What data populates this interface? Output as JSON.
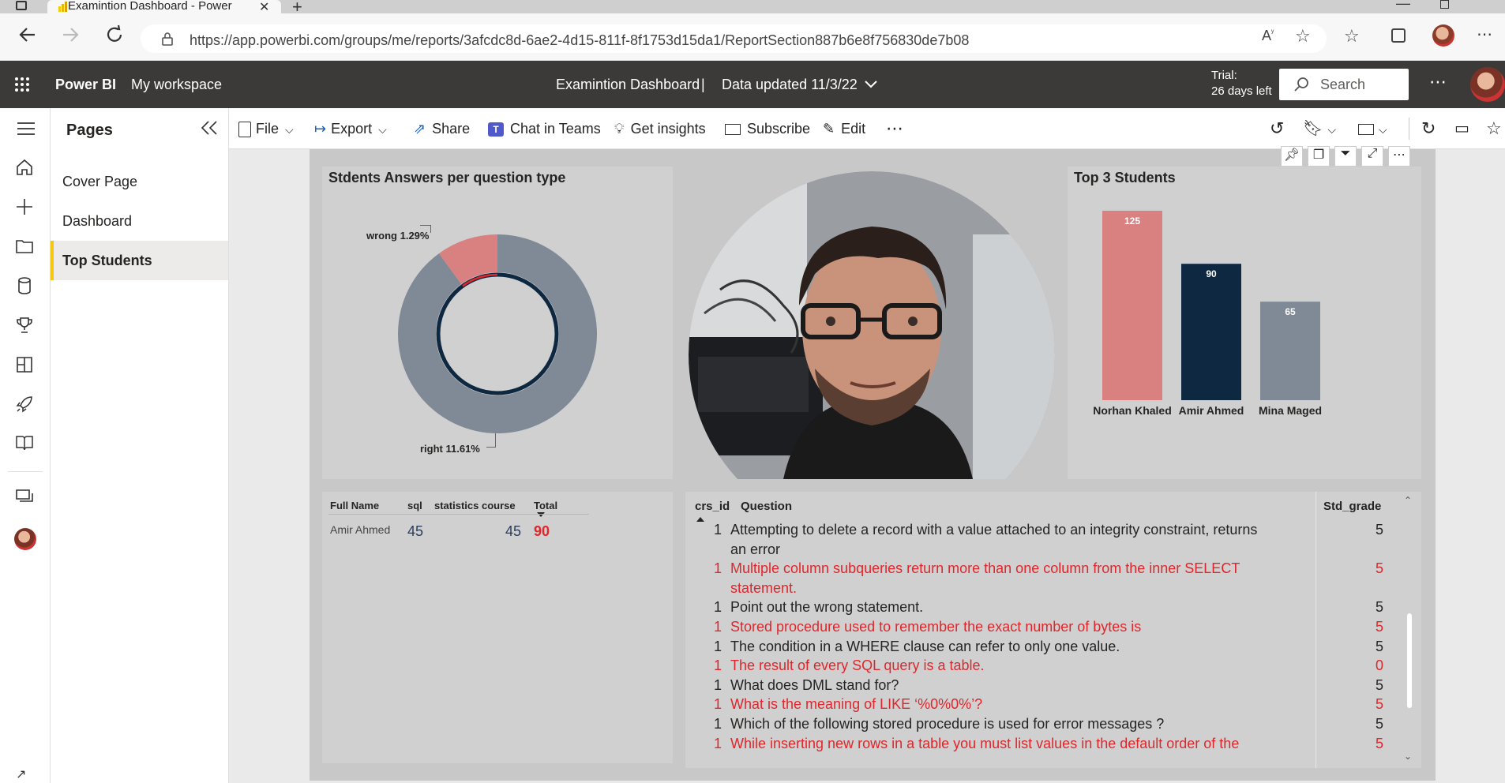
{
  "browser": {
    "tab_title": "Examintion Dashboard - Power BI",
    "url": "https://app.powerbi.com/groups/me/reports/3afcdc8d-6ae2-4d15-811f-8f1753d15da1/ReportSection887b6e8f756830de7b08"
  },
  "header": {
    "app_name": "Power BI",
    "workspace": "My workspace",
    "report_title": "Examintion Dashboard",
    "separator": "|",
    "data_updated": "Data updated 11/3/22",
    "trial_line1": "Trial:",
    "trial_line2": "26 days left",
    "search_placeholder": "Search"
  },
  "pages_pane": {
    "title": "Pages",
    "items": [
      {
        "label": "Cover Page",
        "active": false
      },
      {
        "label": "Dashboard",
        "active": false
      },
      {
        "label": "Top Students",
        "active": true
      }
    ]
  },
  "commands": {
    "file": "File",
    "export": "Export",
    "share": "Share",
    "chat": "Chat in Teams",
    "insights": "Get insights",
    "subscribe": "Subscribe",
    "edit": "Edit"
  },
  "donut_visual": {
    "title": "Stdents Answers per question type",
    "chart_data": {
      "type": "pie",
      "slices": [
        {
          "label": "wrong",
          "percent": 1.29,
          "color": "#d98080"
        },
        {
          "label": "right",
          "percent": 11.61,
          "color": "#808a96"
        }
      ],
      "annotations": [
        "wrong 1.29%",
        "right 11.61%"
      ]
    }
  },
  "bar_visual": {
    "title": "Top 3 Students",
    "chart_data": {
      "type": "bar",
      "categories": [
        "Norhan Khaled",
        "Amir Ahmed",
        "Mina Maged"
      ],
      "values": [
        125,
        90,
        65
      ],
      "colors": [
        "#d98080",
        "#0e2841",
        "#808a96"
      ],
      "data_labels": [
        "125",
        "90",
        "65"
      ]
    }
  },
  "summary_table": {
    "headers": [
      "Full Name",
      "sql",
      "statistics course",
      "Total"
    ],
    "rows": [
      {
        "name": "Amir Ahmed",
        "sql": "45",
        "statistics": "45",
        "total": "90"
      }
    ]
  },
  "questions_table": {
    "headers": [
      "crs_id",
      "Question",
      "Std_grade"
    ],
    "rows": [
      {
        "crs_id": "1",
        "question": "Attempting to delete a record with a value attached to an integrity constraint, returns",
        "question_cont": "an error",
        "grade": "5",
        "highlight": false
      },
      {
        "crs_id": "1",
        "question": "Multiple column subqueries return more than one column from the inner SELECT",
        "question_cont": "statement.",
        "grade": "5",
        "highlight": true
      },
      {
        "crs_id": "1",
        "question": "Point out the wrong statement.",
        "grade": "5",
        "highlight": false
      },
      {
        "crs_id": "1",
        "question": "Stored procedure used to remember the exact number of bytes is",
        "grade": "5",
        "highlight": true
      },
      {
        "crs_id": "1",
        "question": "The condition in a WHERE clause can refer to only one value.",
        "grade": "5",
        "highlight": false
      },
      {
        "crs_id": "1",
        "question": "The result of every SQL query is a table.",
        "grade": "0",
        "highlight": true
      },
      {
        "crs_id": "1",
        "question": "What does DML stand for?",
        "grade": "5",
        "highlight": false
      },
      {
        "crs_id": "1",
        "question": "What is the meaning of LIKE ‘%0%0%’?",
        "grade": "5",
        "highlight": true
      },
      {
        "crs_id": "1",
        "question": "Which of the following stored procedure is used for error messages ?",
        "grade": "5",
        "highlight": false
      },
      {
        "crs_id": "1",
        "question": "While inserting new rows in a table you must list values in the default order of the",
        "grade": "5",
        "highlight": true
      }
    ]
  }
}
